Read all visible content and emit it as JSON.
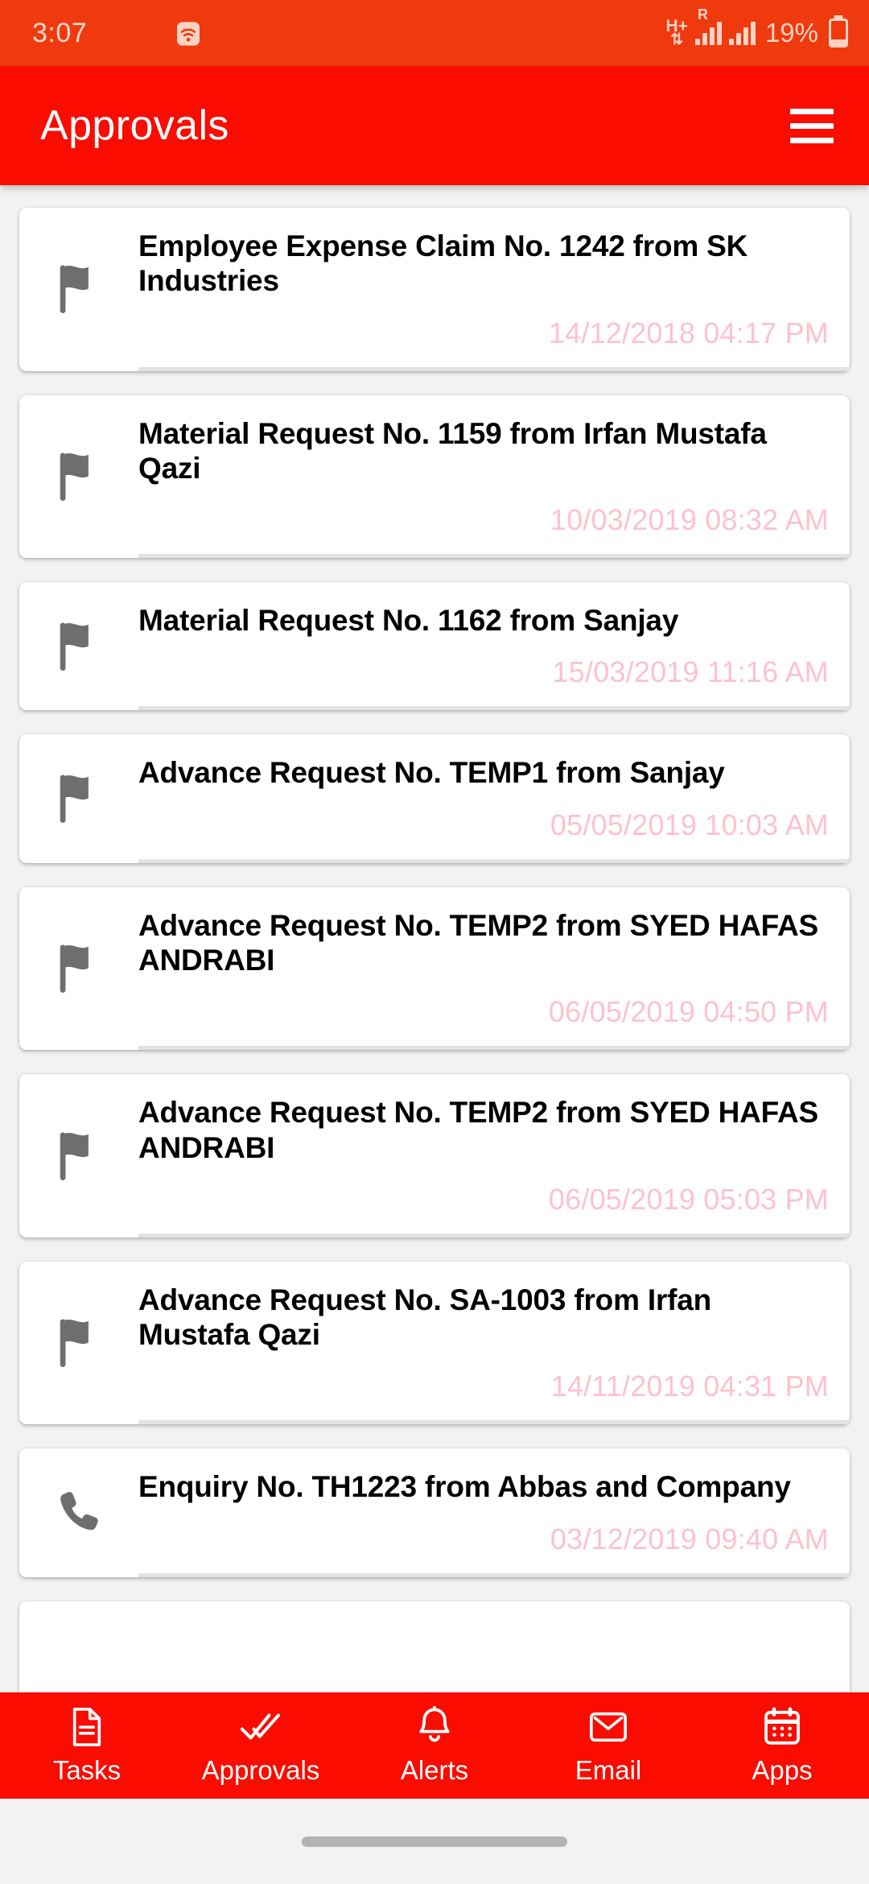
{
  "status_bar": {
    "time": "3:07",
    "battery_percent": "19%",
    "network_type": "H+",
    "roaming_indicator": "R",
    "icons": [
      "youtube-icon",
      "image-icon",
      "wifi-icon",
      "data-transfer-icon",
      "signal-icon",
      "signal-icon-2",
      "battery-icon"
    ],
    "bg_color": "#ef3a0d",
    "fg_color": "#ffd2c4"
  },
  "app_bar": {
    "title": "Approvals",
    "menu_icon": "hamburger-menu-icon",
    "bg_color": "#fa0c00",
    "title_color": "#ffffff"
  },
  "theme": {
    "accent": "#fa0c00",
    "card_bg": "#ffffff",
    "page_bg": "#f2f2f2",
    "date_color": "#fcc2cd",
    "icon_gray": "#6e6e6e"
  },
  "list": {
    "items": [
      {
        "icon": "flag-icon",
        "title": "Employee Expense Claim No. 1242 from SK Industries",
        "date": "14/12/2018 04:17 PM"
      },
      {
        "icon": "flag-icon",
        "title": "Material Request No. 1159 from Irfan Mustafa Qazi",
        "date": "10/03/2019 08:32 AM"
      },
      {
        "icon": "flag-icon",
        "title": "Material Request No. 1162 from Sanjay",
        "date": "15/03/2019 11:16 AM"
      },
      {
        "icon": "flag-icon",
        "title": "Advance Request No. TEMP1 from Sanjay",
        "date": "05/05/2019 10:03 AM"
      },
      {
        "icon": "flag-icon",
        "title": "Advance Request No. TEMP2 from SYED HAFAS ANDRABI",
        "date": "06/05/2019 04:50 PM"
      },
      {
        "icon": "flag-icon",
        "title": "Advance Request No. TEMP2 from SYED HAFAS ANDRABI",
        "date": "06/05/2019 05:03 PM"
      },
      {
        "icon": "flag-icon",
        "title": "Advance Request No. SA-1003 from Irfan Mustafa Qazi",
        "date": "14/11/2019 04:31 PM"
      },
      {
        "icon": "phone-icon",
        "title": "Enquiry No. TH1223 from Abbas and Company",
        "date": "03/12/2019 09:40 AM"
      }
    ]
  },
  "bottom_nav": {
    "items": [
      {
        "label": "Tasks",
        "icon": "document-icon"
      },
      {
        "label": "Approvals",
        "icon": "double-check-icon"
      },
      {
        "label": "Alerts",
        "icon": "bell-icon"
      },
      {
        "label": "Email",
        "icon": "envelope-icon"
      },
      {
        "label": "Apps",
        "icon": "calendar-grid-icon"
      }
    ],
    "active": "Approvals"
  }
}
